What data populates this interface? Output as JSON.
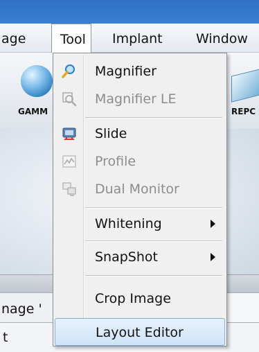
{
  "menubar": {
    "items": [
      "age",
      "Tool",
      "Implant",
      "Window"
    ]
  },
  "toolbar": {
    "gamma_label": "GAMM",
    "report_label": "REPC"
  },
  "tab_strip": {
    "label": "nage '"
  },
  "bottom": {
    "label": "t"
  },
  "tool_menu": {
    "items": [
      {
        "label": "Magnifier",
        "icon": "magnifier-icon",
        "enabled": true
      },
      {
        "label": "Magnifier LE",
        "icon": "magnifier-le-icon",
        "enabled": false
      },
      {
        "label": "Slide",
        "icon": "slide-icon",
        "enabled": true
      },
      {
        "label": "Profile",
        "icon": "profile-icon",
        "enabled": false
      },
      {
        "label": "Dual Monitor",
        "icon": "dual-monitor-icon",
        "enabled": false
      },
      {
        "label": "Whitening",
        "has_submenu": true,
        "enabled": true
      },
      {
        "label": "SnapShot",
        "has_submenu": true,
        "enabled": true
      },
      {
        "label": "Crop Image",
        "enabled": true
      },
      {
        "label": "Layout Editor",
        "enabled": true,
        "highlighted": true
      }
    ]
  },
  "colors": {
    "titlebar": "#3575c8",
    "highlight": "#cfe4f8",
    "disabled_text": "#8c8c8c"
  }
}
